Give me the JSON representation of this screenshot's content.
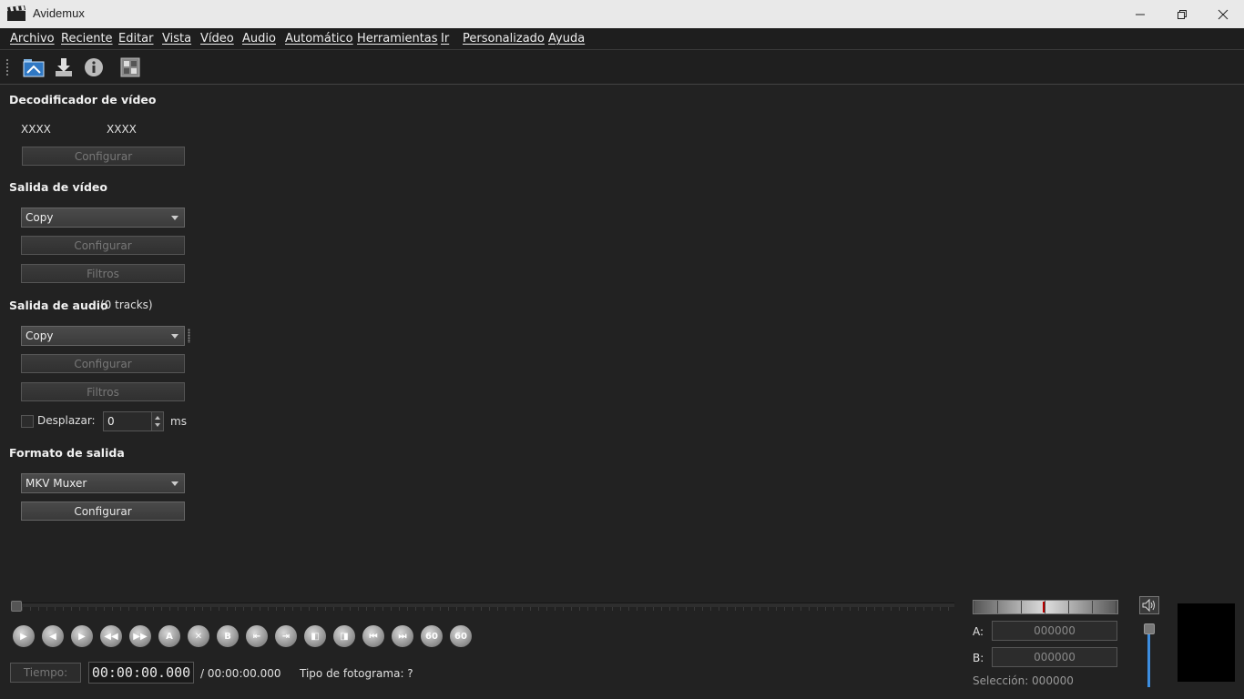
{
  "window": {
    "title": "Avidemux",
    "icon": "clapperboard-icon",
    "controls": [
      "minimize-icon",
      "restore-icon",
      "close-icon"
    ]
  },
  "menu": [
    "Archivo",
    "Reciente",
    "Editar",
    "Vista",
    "Vídeo",
    "Audio",
    "Automático",
    "Herramientas",
    "Ir",
    "Personalizado",
    "Ayuda"
  ],
  "toolbar": [
    "open-file-icon",
    "save-file-icon",
    "info-icon",
    "calculator-icon"
  ],
  "video_decoder": {
    "title": "Decodificador de vídeo",
    "codec_left": "XXXX",
    "codec_right": "XXXX",
    "configure_label": "Configurar"
  },
  "video_output": {
    "title": "Salida de vídeo",
    "selected": "Copy",
    "configure_label": "Configurar",
    "filters_label": "Filtros"
  },
  "audio_output": {
    "title": "Salida de audio",
    "tracks": "(0 tracks)",
    "selected": "Copy",
    "configure_label": "Configurar",
    "filters_label": "Filtros",
    "shift_label": "Desplazar:",
    "shift_value": "0",
    "shift_unit": "ms"
  },
  "output_format": {
    "title": "Formato de salida",
    "selected": "MKV Muxer",
    "configure_label": "Configurar"
  },
  "navigation": {
    "buttons": [
      "play",
      "previous-frame",
      "next-frame",
      "rewind",
      "fast-forward",
      "set-marker-a",
      "delete",
      "set-marker-b",
      "previous-keyframe",
      "next-keyframe",
      "previous-black",
      "next-black",
      "go-first",
      "go-last",
      "back-60",
      "forward-60"
    ],
    "labels": {
      "set-marker-a": "A",
      "set-marker-b": "B",
      "back-60": "60",
      "forward-60": "60"
    }
  },
  "time": {
    "button_label": "Tiempo:",
    "current": "00:00:00.000",
    "total": "/ 00:00:00.000",
    "frame_type": "Tipo de fotograma:  ?"
  },
  "selection": {
    "a_label": "A:",
    "a_value": "000000",
    "b_label": "B:",
    "b_value": "000000",
    "selection_text": "Selección: 000000"
  }
}
